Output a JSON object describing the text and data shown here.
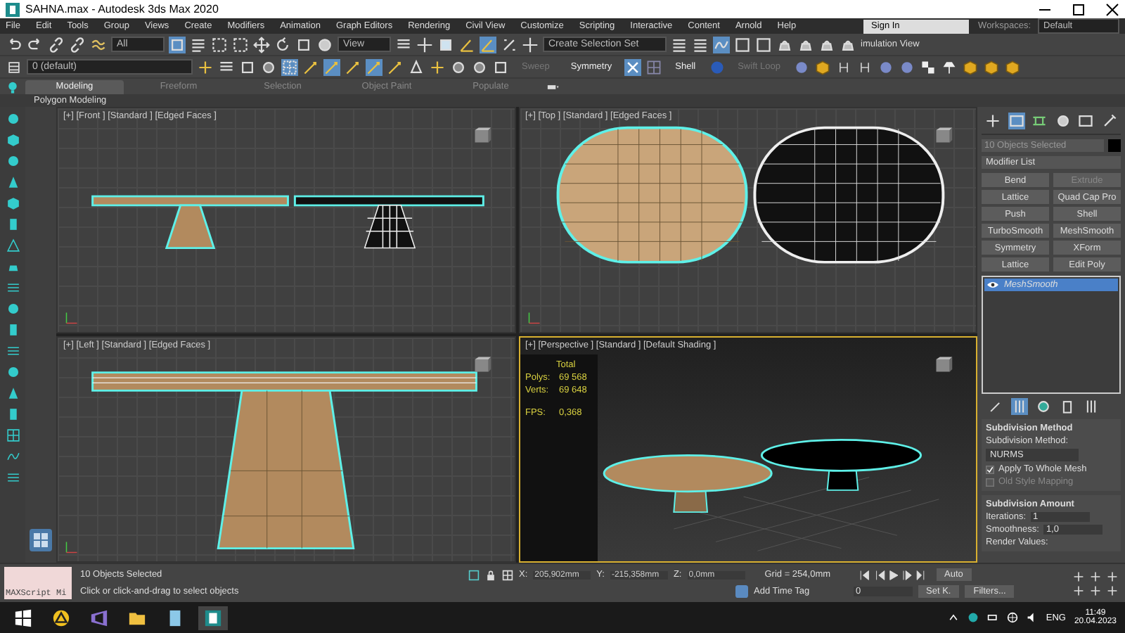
{
  "window": {
    "title": "SAHNA.max - Autodesk 3ds Max 2020"
  },
  "menu": [
    "File",
    "Edit",
    "Tools",
    "Group",
    "Views",
    "Create",
    "Modifiers",
    "Animation",
    "Graph Editors",
    "Rendering",
    "Civil View",
    "Customize",
    "Scripting",
    "Interactive",
    "Content",
    "Arnold",
    "Help"
  ],
  "account": {
    "label": "Sign In"
  },
  "workspaces": {
    "label": "Workspaces:",
    "value": "Default"
  },
  "toolbar": {
    "filter": "All",
    "reference": "View",
    "selection_set": "Create Selection Set",
    "simulation": "imulation View"
  },
  "toolbar_2": {
    "layer": "0 (default)",
    "labels": [
      {
        "label": "Sweep",
        "disabled": true
      },
      {
        "label": "Symmetry",
        "disabled": false
      },
      {
        "label": "Shell",
        "disabled": false
      },
      {
        "label": "Swift Loop",
        "disabled": true
      }
    ]
  },
  "ribbon": {
    "tabs": [
      {
        "label": "Modeling",
        "selected": true
      },
      {
        "label": "Freeform",
        "selected": false
      },
      {
        "label": "Selection",
        "selected": false
      },
      {
        "label": "Object Paint",
        "selected": false
      },
      {
        "label": "Populate",
        "selected": false
      }
    ],
    "panel": "Polygon Modeling"
  },
  "viewports": [
    {
      "kind": "front",
      "label": "[+] [Front ] [Standard ] [Edged Faces ]",
      "active": false
    },
    {
      "kind": "top",
      "label": "[+] [Top ] [Standard ] [Edged Faces ]",
      "active": false
    },
    {
      "kind": "left",
      "label": "[+] [Left ] [Standard ] [Edged Faces ]",
      "active": false
    },
    {
      "kind": "perspective",
      "label": "[+] [Perspective ] [Standard ] [Default Shading ]",
      "active": true,
      "stats": {
        "heading": "Total",
        "rows": [
          {
            "name": "Polys:",
            "value": "69 568"
          },
          {
            "name": "Verts:",
            "value": "69 648"
          },
          {
            "name": "FPS:",
            "value": "0,368"
          }
        ]
      }
    }
  ],
  "command_panel": {
    "selection": "10 Objects Selected",
    "modifier_list": "Modifier List",
    "modifiers": [
      {
        "label": "Bend",
        "disabled": false
      },
      {
        "label": "Extrude",
        "disabled": true
      },
      {
        "label": "Lattice",
        "disabled": false
      },
      {
        "label": "Quad Cap Pro",
        "disabled": false
      },
      {
        "label": "Push",
        "disabled": false
      },
      {
        "label": "Shell",
        "disabled": false
      },
      {
        "label": "TurboSmooth",
        "disabled": false
      },
      {
        "label": "MeshSmooth",
        "disabled": false
      },
      {
        "label": "Symmetry",
        "disabled": false
      },
      {
        "label": "XForm",
        "disabled": false
      },
      {
        "label": "Lattice",
        "disabled": false
      },
      {
        "label": "Edit Poly",
        "disabled": false
      }
    ],
    "stack": [
      {
        "label": "MeshSmooth",
        "selected": true
      }
    ],
    "method_rollout": {
      "title": "Subdivision Method",
      "field_label": "Subdivision Method:",
      "value": "NURMS",
      "options": [
        {
          "label": "Apply To Whole Mesh",
          "checked": true
        },
        {
          "label": "Old Style Mapping",
          "checked": false
        }
      ]
    },
    "amount_rollout": {
      "title": "Subdivision Amount",
      "fields": [
        {
          "label": "Iterations:",
          "value": "1"
        },
        {
          "label": "Smoothness:",
          "value": "1,0"
        }
      ],
      "render_label": "Render Values:"
    }
  },
  "status": {
    "script_field": "MAXScript Mi",
    "selection": "10 Objects Selected",
    "prompt": "Click or click-and-drag to select objects",
    "coords": [
      {
        "axis": "X:",
        "value": "205,902mm"
      },
      {
        "axis": "Y:",
        "value": "-215,358mm"
      },
      {
        "axis": "Z:",
        "value": "0,0mm"
      }
    ],
    "grid": "Grid = 254,0mm",
    "time_tag": "Add Time Tag",
    "auto": "Auto",
    "frame": "0",
    "set_key": "Set K.",
    "filters": "Filters..."
  },
  "taskbar": {
    "language": "ENG",
    "time": "11:49",
    "date": "20.04.2023"
  }
}
